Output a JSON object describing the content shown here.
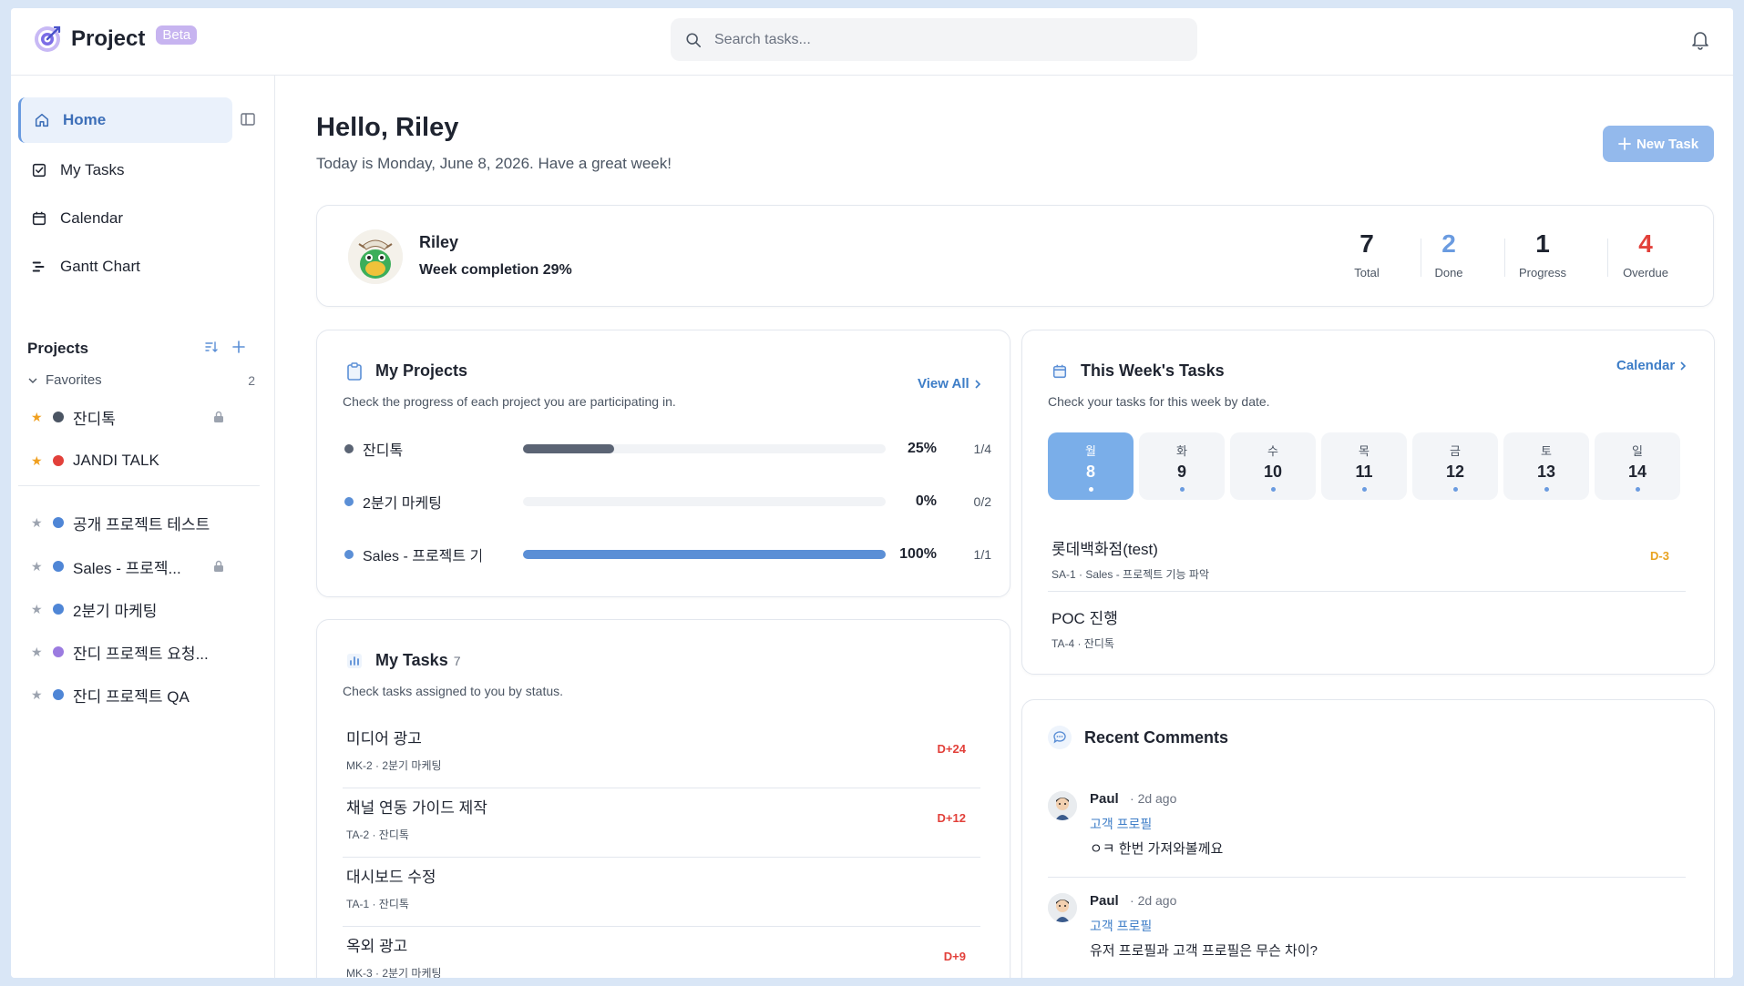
{
  "header": {
    "app_name": "Project",
    "badge": "Beta",
    "search_placeholder": "Search tasks..."
  },
  "sidebar": {
    "nav": [
      {
        "label": "Home",
        "icon": "home-icon"
      },
      {
        "label": "My Tasks",
        "icon": "checkbox-icon"
      },
      {
        "label": "Calendar",
        "icon": "calendar-icon"
      },
      {
        "label": "Gantt Chart",
        "icon": "gantt-icon"
      }
    ],
    "projects_title": "Projects",
    "favorites_label": "Favorites",
    "favorites_count": "2",
    "favorites": [
      {
        "name": "잔디톡",
        "color": "#4b5563",
        "locked": true
      },
      {
        "name": "JANDI TALK",
        "color": "#e2403a",
        "locked": false
      }
    ],
    "projects": [
      {
        "name": "공개 프로젝트 테스트",
        "color": "#4f86d6",
        "locked": false
      },
      {
        "name": "Sales - 프로젝...",
        "color": "#4f86d6",
        "locked": true
      },
      {
        "name": "2분기 마케팅",
        "color": "#4f86d6",
        "locked": false
      },
      {
        "name": "잔디 프로젝트 요청...",
        "color": "#9b7be0",
        "locked": false
      },
      {
        "name": "잔디 프로젝트 QA",
        "color": "#4f86d6",
        "locked": false
      }
    ]
  },
  "main": {
    "greeting": "Hello, Riley",
    "subtitle": "Today is Monday, June 8, 2026. Have a great week!",
    "new_task_label": "New Task",
    "profile": {
      "name": "Riley",
      "week_completion": "Week completion 29%",
      "stats": [
        {
          "value": "7",
          "label": "Total",
          "color": "#1f2430"
        },
        {
          "value": "2",
          "label": "Done",
          "color": "#6a9be0"
        },
        {
          "value": "1",
          "label": "Progress",
          "color": "#1f2430"
        },
        {
          "value": "4",
          "label": "Overdue",
          "color": "#e2403a"
        }
      ]
    },
    "my_projects": {
      "title": "My Projects",
      "desc": "Check the progress of each project you are participating in.",
      "view_all": "View All",
      "rows": [
        {
          "name": "잔디톡",
          "pct_label": "25%",
          "progress": 0.25,
          "frac": "1/4",
          "color": "#5b6474"
        },
        {
          "name": "2분기 마케팅",
          "pct_label": "0%",
          "progress": 0,
          "frac": "0/2",
          "color": "#5b8fd6"
        },
        {
          "name": "Sales - 프로젝트 기능 파악",
          "pct_label": "100%",
          "progress": 1.0,
          "frac": "1/1",
          "color": "#5b8fd6"
        }
      ]
    },
    "my_tasks": {
      "title": "My Tasks",
      "count": "7",
      "desc": "Check tasks assigned to you by status.",
      "items": [
        {
          "title": "미디어 광고",
          "meta": "MK-2 · 2분기 마케팅",
          "dday": "D+24"
        },
        {
          "title": "채널 연동 가이드 제작",
          "meta": "TA-2 · 잔디톡",
          "dday": "D+12"
        },
        {
          "title": "대시보드 수정",
          "meta": "TA-1 · 잔디톡",
          "dday": ""
        },
        {
          "title": "옥외 광고",
          "meta": "MK-3 · 2분기 마케팅",
          "dday": "D+9"
        }
      ]
    },
    "week_tasks": {
      "title": "This Week's Tasks",
      "desc": "Check your tasks for this week by date.",
      "calendar_link": "Calendar",
      "days": [
        {
          "name": "월",
          "date": "8",
          "selected": true
        },
        {
          "name": "화",
          "date": "9",
          "selected": false
        },
        {
          "name": "수",
          "date": "10",
          "selected": false
        },
        {
          "name": "목",
          "date": "11",
          "selected": false
        },
        {
          "name": "금",
          "date": "12",
          "selected": false
        },
        {
          "name": "토",
          "date": "13",
          "selected": false
        },
        {
          "name": "일",
          "date": "14",
          "selected": false
        }
      ],
      "items": [
        {
          "title": "롯데백화점(test)",
          "meta": "SA-1 · Sales - 프로젝트 기능 파악",
          "dday": "D-3"
        },
        {
          "title": "POC 진행",
          "meta": "TA-4 · 잔디톡",
          "dday": ""
        }
      ]
    },
    "comments": {
      "title": "Recent Comments",
      "items": [
        {
          "author": "Paul",
          "time": "2d ago",
          "project": "고객 프로필",
          "text": "ㅇㅋ 한번 가져와볼께요"
        },
        {
          "author": "Paul",
          "time": "2d ago",
          "project": "고객 프로필",
          "text": "유저 프로필과 고객 프로필은 무슨 차이?"
        }
      ]
    }
  }
}
